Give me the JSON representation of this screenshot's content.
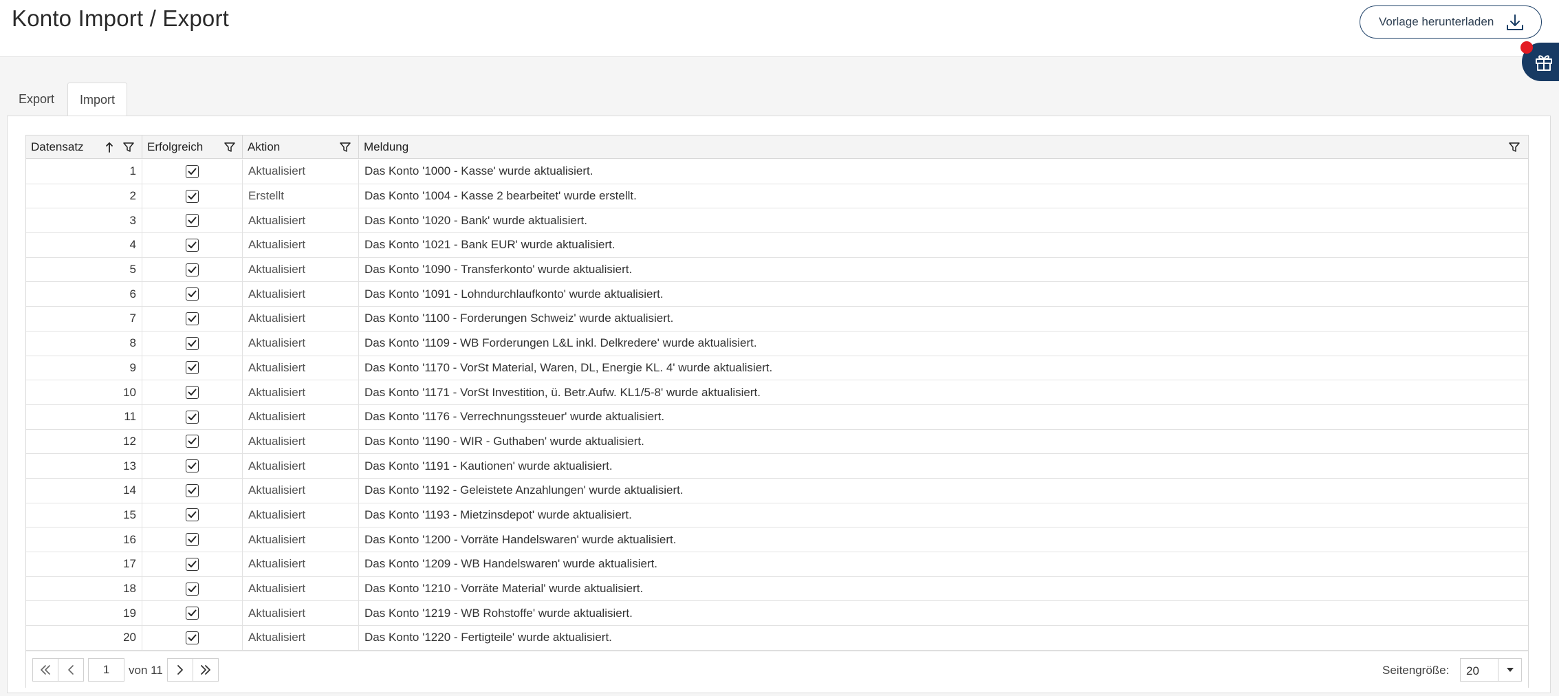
{
  "header": {
    "title": "Konto Import / Export",
    "download_label": "Vorlage herunterladen"
  },
  "tabs": [
    {
      "label": "Export",
      "active": false
    },
    {
      "label": "Import",
      "active": true
    }
  ],
  "table": {
    "columns": [
      "Datensatz",
      "Erfolgreich",
      "Aktion",
      "Meldung"
    ],
    "sort": {
      "column": "Datensatz",
      "direction": "ascending"
    },
    "rows": [
      {
        "id": "1",
        "success": true,
        "action": "Aktualisiert",
        "message": "Das Konto '1000 - Kasse' wurde aktualisiert."
      },
      {
        "id": "2",
        "success": true,
        "action": "Erstellt",
        "message": "Das Konto '1004 - Kasse 2 bearbeitet' wurde erstellt."
      },
      {
        "id": "3",
        "success": true,
        "action": "Aktualisiert",
        "message": "Das Konto '1020 - Bank' wurde aktualisiert."
      },
      {
        "id": "4",
        "success": true,
        "action": "Aktualisiert",
        "message": "Das Konto '1021 - Bank EUR' wurde aktualisiert."
      },
      {
        "id": "5",
        "success": true,
        "action": "Aktualisiert",
        "message": "Das Konto '1090 - Transferkonto' wurde aktualisiert."
      },
      {
        "id": "6",
        "success": true,
        "action": "Aktualisiert",
        "message": "Das Konto '1091 - Lohndurchlaufkonto' wurde aktualisiert."
      },
      {
        "id": "7",
        "success": true,
        "action": "Aktualisiert",
        "message": "Das Konto '1100 - Forderungen Schweiz' wurde aktualisiert."
      },
      {
        "id": "8",
        "success": true,
        "action": "Aktualisiert",
        "message": "Das Konto '1109 - WB Forderungen L&L inkl. Delkredere' wurde aktualisiert."
      },
      {
        "id": "9",
        "success": true,
        "action": "Aktualisiert",
        "message": "Das Konto '1170 - VorSt Material, Waren, DL, Energie KL. 4' wurde aktualisiert."
      },
      {
        "id": "10",
        "success": true,
        "action": "Aktualisiert",
        "message": "Das Konto '1171 - VorSt Investition, ü. Betr.Aufw. KL1/5-8' wurde aktualisiert."
      },
      {
        "id": "11",
        "success": true,
        "action": "Aktualisiert",
        "message": "Das Konto '1176 - Verrechnungssteuer' wurde aktualisiert."
      },
      {
        "id": "12",
        "success": true,
        "action": "Aktualisiert",
        "message": "Das Konto '1190 - WIR - Guthaben' wurde aktualisiert."
      },
      {
        "id": "13",
        "success": true,
        "action": "Aktualisiert",
        "message": "Das Konto '1191 - Kautionen' wurde aktualisiert."
      },
      {
        "id": "14",
        "success": true,
        "action": "Aktualisiert",
        "message": "Das Konto '1192 - Geleistete Anzahlungen' wurde aktualisiert."
      },
      {
        "id": "15",
        "success": true,
        "action": "Aktualisiert",
        "message": "Das Konto '1193 - Mietzinsdepot' wurde aktualisiert."
      },
      {
        "id": "16",
        "success": true,
        "action": "Aktualisiert",
        "message": "Das Konto '1200 - Vorräte Handelswaren' wurde aktualisiert."
      },
      {
        "id": "17",
        "success": true,
        "action": "Aktualisiert",
        "message": "Das Konto '1209 - WB Handelswaren' wurde aktualisiert."
      },
      {
        "id": "18",
        "success": true,
        "action": "Aktualisiert",
        "message": "Das Konto '1210 - Vorräte Material' wurde aktualisiert."
      },
      {
        "id": "19",
        "success": true,
        "action": "Aktualisiert",
        "message": "Das Konto '1219 - WB Rohstoffe' wurde aktualisiert."
      },
      {
        "id": "20",
        "success": true,
        "action": "Aktualisiert",
        "message": "Das Konto '1220 - Fertigteile' wurde aktualisiert."
      }
    ]
  },
  "pager": {
    "current_page": "1",
    "page_of": "von 11",
    "page_size_label": "Seitengröße:",
    "page_size": "20"
  },
  "icons": {
    "download": "download-icon",
    "gift": "gift-icon",
    "filter": "filter-icon",
    "sort": "sort-ascending-icon",
    "check": "checkmark-icon",
    "first": "double-chevron-left-icon",
    "prev": "chevron-left-icon",
    "next": "chevron-right-icon",
    "last": "double-chevron-right-icon",
    "dropdown": "caret-down-icon"
  },
  "colors": {
    "brand": "#173a63",
    "notification": "#e31b23"
  }
}
